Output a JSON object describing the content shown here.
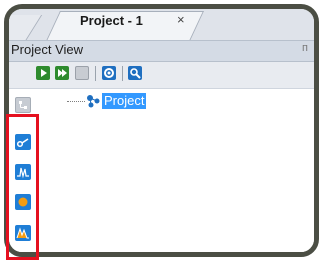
{
  "tab": {
    "title": "Project - 1",
    "close": "×"
  },
  "panel": {
    "title": "Project View",
    "pin": "ᴨ"
  },
  "toolbar": {
    "buttons": [
      "run-icon",
      "step-icon",
      "stop-icon",
      "settings-icon",
      "search-icon"
    ]
  },
  "tree": {
    "root_label": "Project"
  },
  "sidebar": {
    "buttons": [
      "tree-view-icon",
      "link-icon",
      "waveform-icon",
      "circle-icon",
      "spectrum-icon"
    ]
  },
  "colors": {
    "accent": "#3399ff",
    "highlight": "#e5101f",
    "run_green": "#2e8b2e"
  }
}
